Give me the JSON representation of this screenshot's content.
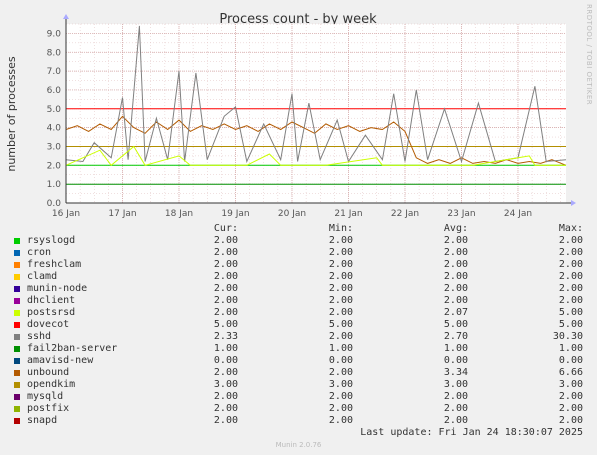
{
  "title": "Process count - by week",
  "side_label": "RRDTOOL / TOBI OETIKER",
  "footer": "Munin 2.0.76",
  "last_update": "Last update:  Fri Jan 24 18:30:07 2025",
  "legend_headers": {
    "cur": "Cur:",
    "min": "Min:",
    "avg": "Avg:",
    "max": "Max:"
  },
  "legend": [
    {
      "name": "rsyslogd",
      "color": "#00cc00",
      "cur": "2.00",
      "min": "2.00",
      "avg": "2.00",
      "max": "2.00"
    },
    {
      "name": "cron",
      "color": "#0066b3",
      "cur": "2.00",
      "min": "2.00",
      "avg": "2.00",
      "max": "2.00"
    },
    {
      "name": "freshclam",
      "color": "#ff8000",
      "cur": "2.00",
      "min": "2.00",
      "avg": "2.00",
      "max": "2.00"
    },
    {
      "name": "clamd",
      "color": "#ffcc00",
      "cur": "2.00",
      "min": "2.00",
      "avg": "2.00",
      "max": "2.00"
    },
    {
      "name": "munin-node",
      "color": "#330099",
      "cur": "2.00",
      "min": "2.00",
      "avg": "2.00",
      "max": "2.00"
    },
    {
      "name": "dhclient",
      "color": "#990099",
      "cur": "2.00",
      "min": "2.00",
      "avg": "2.00",
      "max": "2.00"
    },
    {
      "name": "postsrsd",
      "color": "#ccff00",
      "cur": "2.00",
      "min": "2.00",
      "avg": "2.07",
      "max": "5.00"
    },
    {
      "name": "dovecot",
      "color": "#ff0000",
      "cur": "5.00",
      "min": "5.00",
      "avg": "5.00",
      "max": "5.00"
    },
    {
      "name": "sshd",
      "color": "#808080",
      "cur": "2.33",
      "min": "2.00",
      "avg": "2.70",
      "max": "30.30"
    },
    {
      "name": "fail2ban-server",
      "color": "#008f00",
      "cur": "1.00",
      "min": "1.00",
      "avg": "1.00",
      "max": "1.00"
    },
    {
      "name": "amavisd-new",
      "color": "#00487d",
      "cur": "0.00",
      "min": "0.00",
      "avg": "0.00",
      "max": "0.00"
    },
    {
      "name": "unbound",
      "color": "#b35a00",
      "cur": "2.00",
      "min": "2.00",
      "avg": "3.34",
      "max": "6.66"
    },
    {
      "name": "opendkim",
      "color": "#b38f00",
      "cur": "3.00",
      "min": "3.00",
      "avg": "3.00",
      "max": "3.00"
    },
    {
      "name": "mysqld",
      "color": "#6b006b",
      "cur": "2.00",
      "min": "2.00",
      "avg": "2.00",
      "max": "2.00"
    },
    {
      "name": "postfix",
      "color": "#8fb300",
      "cur": "2.00",
      "min": "2.00",
      "avg": "2.00",
      "max": "2.00"
    },
    {
      "name": "snapd",
      "color": "#b30000",
      "cur": "2.00",
      "min": "2.00",
      "avg": "2.00",
      "max": "2.00"
    }
  ],
  "chart_data": {
    "type": "line",
    "title": "Process count - by week",
    "ylabel": "number of processes",
    "xlabel": "",
    "ylim": [
      0,
      9.5
    ],
    "yticks": [
      "0.0",
      "1.0",
      "2.0",
      "3.0",
      "4.0",
      "5.0",
      "6.0",
      "7.0",
      "8.0",
      "9.0"
    ],
    "xticks": [
      "16 Jan",
      "17 Jan",
      "18 Jan",
      "19 Jan",
      "20 Jan",
      "21 Jan",
      "22 Jan",
      "23 Jan",
      "24 Jan"
    ],
    "x_range_days": [
      16.0,
      24.85
    ],
    "grid": true,
    "series": [
      {
        "name": "dovecot",
        "color": "#ff0000",
        "points": [
          [
            16.0,
            5.0
          ],
          [
            24.85,
            5.0
          ]
        ]
      },
      {
        "name": "opendkim",
        "color": "#b38f00",
        "points": [
          [
            16.0,
            3.0
          ],
          [
            24.85,
            3.0
          ]
        ]
      },
      {
        "name": "fail2ban-server",
        "color": "#008f00",
        "points": [
          [
            16.0,
            1.0
          ],
          [
            24.85,
            1.0
          ]
        ]
      },
      {
        "name": "rsyslogd",
        "color": "#00cc00",
        "points": [
          [
            16.0,
            2.0
          ],
          [
            24.85,
            2.0
          ]
        ]
      },
      {
        "name": "unbound",
        "color": "#b35a00",
        "points": [
          [
            16.0,
            3.9
          ],
          [
            16.2,
            4.1
          ],
          [
            16.4,
            3.8
          ],
          [
            16.6,
            4.2
          ],
          [
            16.8,
            3.9
          ],
          [
            17.0,
            4.6
          ],
          [
            17.2,
            4.0
          ],
          [
            17.4,
            3.7
          ],
          [
            17.6,
            4.3
          ],
          [
            17.8,
            3.9
          ],
          [
            18.0,
            4.4
          ],
          [
            18.2,
            3.8
          ],
          [
            18.4,
            4.1
          ],
          [
            18.6,
            3.9
          ],
          [
            18.8,
            4.2
          ],
          [
            19.0,
            3.9
          ],
          [
            19.2,
            4.1
          ],
          [
            19.4,
            3.8
          ],
          [
            19.6,
            4.2
          ],
          [
            19.8,
            3.9
          ],
          [
            20.0,
            4.3
          ],
          [
            20.2,
            4.0
          ],
          [
            20.4,
            3.7
          ],
          [
            20.6,
            4.2
          ],
          [
            20.8,
            3.9
          ],
          [
            21.0,
            4.1
          ],
          [
            21.2,
            3.8
          ],
          [
            21.4,
            4.0
          ],
          [
            21.6,
            3.9
          ],
          [
            21.8,
            4.3
          ],
          [
            22.0,
            3.8
          ],
          [
            22.2,
            2.4
          ],
          [
            22.4,
            2.1
          ],
          [
            22.6,
            2.3
          ],
          [
            22.8,
            2.1
          ],
          [
            23.0,
            2.4
          ],
          [
            23.2,
            2.1
          ],
          [
            23.4,
            2.2
          ],
          [
            23.6,
            2.1
          ],
          [
            23.8,
            2.3
          ],
          [
            24.0,
            2.1
          ],
          [
            24.2,
            2.2
          ],
          [
            24.4,
            2.1
          ],
          [
            24.6,
            2.3
          ],
          [
            24.85,
            2.0
          ]
        ]
      },
      {
        "name": "sshd",
        "color": "#808080",
        "points": [
          [
            16.0,
            2.3
          ],
          [
            16.3,
            2.2
          ],
          [
            16.5,
            3.2
          ],
          [
            16.8,
            2.4
          ],
          [
            17.0,
            5.6
          ],
          [
            17.1,
            2.3
          ],
          [
            17.3,
            9.4
          ],
          [
            17.4,
            2.2
          ],
          [
            17.6,
            4.5
          ],
          [
            17.8,
            2.3
          ],
          [
            18.0,
            7.0
          ],
          [
            18.1,
            2.2
          ],
          [
            18.3,
            6.9
          ],
          [
            18.5,
            2.3
          ],
          [
            18.8,
            4.6
          ],
          [
            19.0,
            5.1
          ],
          [
            19.2,
            2.2
          ],
          [
            19.5,
            4.2
          ],
          [
            19.8,
            2.3
          ],
          [
            20.0,
            5.8
          ],
          [
            20.1,
            2.2
          ],
          [
            20.3,
            5.3
          ],
          [
            20.5,
            2.3
          ],
          [
            20.8,
            4.4
          ],
          [
            21.0,
            2.2
          ],
          [
            21.3,
            3.6
          ],
          [
            21.6,
            2.3
          ],
          [
            21.8,
            5.8
          ],
          [
            22.0,
            2.2
          ],
          [
            22.2,
            6.0
          ],
          [
            22.4,
            2.3
          ],
          [
            22.7,
            5.0
          ],
          [
            23.0,
            2.2
          ],
          [
            23.3,
            5.3
          ],
          [
            23.6,
            2.2
          ],
          [
            24.0,
            2.4
          ],
          [
            24.3,
            6.2
          ],
          [
            24.5,
            2.2
          ],
          [
            24.85,
            2.3
          ]
        ]
      },
      {
        "name": "postsrsd",
        "color": "#ccff00",
        "points": [
          [
            16.0,
            2.0
          ],
          [
            16.6,
            2.8
          ],
          [
            16.8,
            2.0
          ],
          [
            17.2,
            3.0
          ],
          [
            17.4,
            2.0
          ],
          [
            18.0,
            2.5
          ],
          [
            18.2,
            2.0
          ],
          [
            19.2,
            2.0
          ],
          [
            19.6,
            2.6
          ],
          [
            19.8,
            2.0
          ],
          [
            20.6,
            2.0
          ],
          [
            21.5,
            2.4
          ],
          [
            21.6,
            2.0
          ],
          [
            23.2,
            2.0
          ],
          [
            24.2,
            2.5
          ],
          [
            24.3,
            2.0
          ],
          [
            24.85,
            2.0
          ]
        ]
      }
    ]
  }
}
